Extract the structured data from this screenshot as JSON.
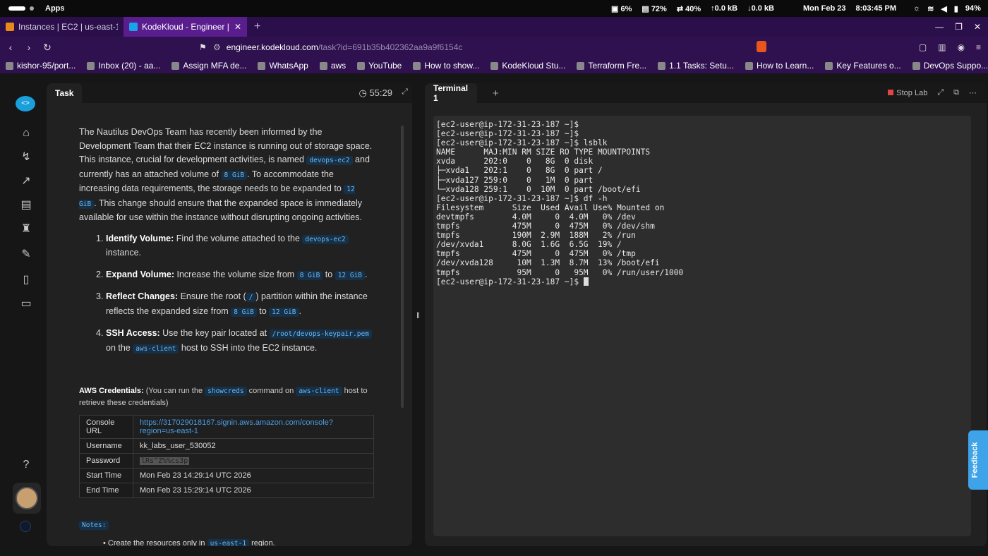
{
  "os": {
    "apps": "Apps",
    "cpu": "6%",
    "mem": "72%",
    "swap": "40%",
    "up": "0.0 kB",
    "down": "0.0 kB",
    "date": "Mon Feb 23",
    "time": "8:03:45 PM",
    "battery": "94%"
  },
  "tabs": [
    {
      "label": "Instances | EC2 | us-east-1"
    },
    {
      "label": "KodeKloud - Engineer | "
    }
  ],
  "url": {
    "host": "engineer.kodekloud.com",
    "path": "/task?id=691b35b402362aa9a9f6154c"
  },
  "bookmarks": [
    "kishor-95/port...",
    "Inbox (20) - aa...",
    "Assign MFA de...",
    "WhatsApp",
    "aws",
    "YouTube",
    "How to show...",
    "KodeKloud Stu...",
    "Terraform Fre...",
    "1.1 Tasks: Setu...",
    "How to Learn...",
    "Key Features o...",
    "DevOps Suppo..."
  ],
  "task": {
    "tab": "Task",
    "timer": "55:29",
    "intro_1": "The Nautilus DevOps Team has recently been informed by the Development Team that their EC2 instance is running out of storage space. This instance, crucial for development activities, is named ",
    "instance": "devops-ec2",
    "intro_2": " and currently has an attached volume of ",
    "size_old": "8 GiB",
    "intro_3": ". To accommodate the increasing data requirements, the storage needs to be expanded to ",
    "size_new": "12 GiB",
    "intro_4": ". This change should ensure that the expanded space is immediately available for use within the instance without disrupting ongoing activities.",
    "steps": [
      {
        "num": "1.",
        "title": "Identify Volume:",
        "text": " Find the volume attached to the ",
        "code": "devops-ec2",
        "tail": " instance."
      },
      {
        "num": "2.",
        "title": "Expand Volume:",
        "text": " Increase the volume size from ",
        "code": "8 GiB",
        "mid": " to ",
        "code2": "12 GiB",
        "tail": "."
      },
      {
        "num": "3.",
        "title": "Reflect Changes:",
        "text": " Ensure the root (",
        "code": "/",
        "mid": ") partition within the instance reflects the expanded size from ",
        "code2": "8 GiB",
        "mid2": " to ",
        "code3": "12 GiB",
        "tail": "."
      },
      {
        "num": "4.",
        "title": "SSH Access:",
        "text": " Use the key pair located at ",
        "code": "/root/devops-keypair.pem",
        "mid": " on the ",
        "code2": "aws-client",
        "tail": " host to SSH into the EC2 instance."
      }
    ],
    "creds_title": "AWS Credentials:",
    "creds_text_1": " (You can run the ",
    "creds_cmd": "showcreds",
    "creds_text_2": " command on ",
    "creds_host": "aws-client",
    "creds_text_3": " host to retrieve these credentials)",
    "table": [
      {
        "k": "Console URL",
        "v": "https://317029018167.signin.aws.amazon.com/console?region=us-east-1"
      },
      {
        "k": "Username",
        "v": "kk_labs_user_530052"
      },
      {
        "k": "Password",
        "v": "lRs^Z%%cs3p"
      },
      {
        "k": "Start Time",
        "v": "Mon Feb 23 14:29:14 UTC 2026"
      },
      {
        "k": "End Time",
        "v": "Mon Feb 23 15:29:14 UTC 2026"
      }
    ],
    "notes": "Notes:",
    "note_1a": "Create the resources only in ",
    "note_1b": "us-east-1",
    "note_1c": " region."
  },
  "terminal": {
    "tab": "Terminal 1",
    "stop": "Stop Lab",
    "lines": [
      "[ec2-user@ip-172-31-23-187 ~]$",
      "[ec2-user@ip-172-31-23-187 ~]$",
      "[ec2-user@ip-172-31-23-187 ~]$ lsblk",
      "NAME      MAJ:MIN RM SIZE RO TYPE MOUNTPOINTS",
      "xvda      202:0    0   8G  0 disk",
      "├─xvda1   202:1    0   8G  0 part /",
      "├─xvda127 259:0    0   1M  0 part",
      "└─xvda128 259:1    0  10M  0 part /boot/efi",
      "[ec2-user@ip-172-31-23-187 ~]$ df -h",
      "Filesystem      Size  Used Avail Use% Mounted on",
      "devtmpfs        4.0M     0  4.0M   0% /dev",
      "tmpfs           475M     0  475M   0% /dev/shm",
      "tmpfs           190M  2.9M  188M   2% /run",
      "/dev/xvda1      8.0G  1.6G  6.5G  19% /",
      "tmpfs           475M     0  475M   0% /tmp",
      "/dev/xvda128     10M  1.3M  8.7M  13% /boot/efi",
      "tmpfs            95M     0   95M   0% /run/user/1000"
    ],
    "prompt": "[ec2-user@ip-172-31-23-187 ~]$ "
  },
  "feedback": "Feedback",
  "colors": {
    "accent": "#5a1d8e",
    "link": "#4a9fe8",
    "code_bg": "#163047"
  }
}
